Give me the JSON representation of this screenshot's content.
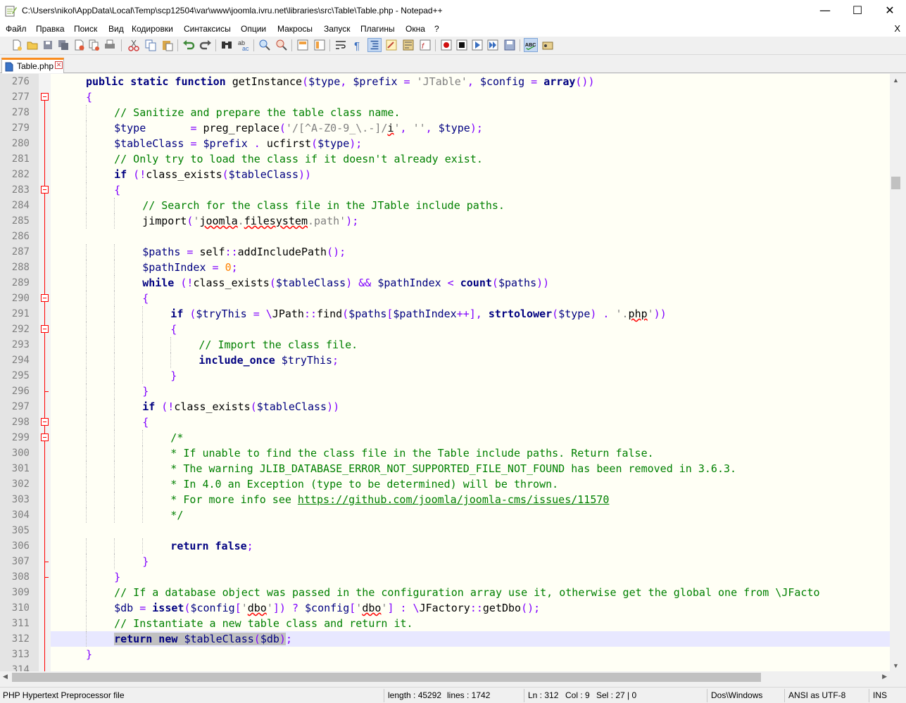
{
  "window": {
    "title": "C:\\Users\\nikol\\AppData\\Local\\Temp\\scp12504\\var\\www\\joomla.ivru.net\\libraries\\src\\Table\\Table.php - Notepad++",
    "minimize": "—",
    "maximize": "☐",
    "close": "✕"
  },
  "menu": {
    "items": [
      "Файл",
      "Правка",
      "Поиск",
      "Вид",
      "Кодировки",
      "Синтаксисы",
      "Опции",
      "Макросы",
      "Запуск",
      "Плагины",
      "Окна",
      "?"
    ],
    "close": "X"
  },
  "toolbar": {
    "icons": [
      "new-file-icon",
      "open-file-icon",
      "save-icon",
      "save-all-icon",
      "close-icon",
      "close-all-icon",
      "print-icon",
      "cut-icon",
      "copy-icon",
      "paste-icon",
      "undo-icon",
      "redo-icon",
      "find-icon",
      "replace-icon",
      "zoom-in-icon",
      "zoom-out-icon",
      "sync-v-icon",
      "sync-h-icon",
      "word-wrap-icon",
      "show-all-chars-icon",
      "indent-guide-icon",
      "udl-icon",
      "doc-map-icon",
      "function-list-icon",
      "record-macro-icon",
      "stop-macro-icon",
      "play-macro-icon",
      "run-macro-multiple-icon",
      "save-macro-icon",
      "spell-check-icon",
      "spell-options-icon"
    ]
  },
  "tab": {
    "label": "Table.php",
    "close": "✕"
  },
  "editor": {
    "lines": [
      {
        "n": "276"
      },
      {
        "n": "277"
      },
      {
        "n": "278"
      },
      {
        "n": "279"
      },
      {
        "n": "280"
      },
      {
        "n": "281"
      },
      {
        "n": "282"
      },
      {
        "n": "283"
      },
      {
        "n": "284"
      },
      {
        "n": "285"
      },
      {
        "n": "286"
      },
      {
        "n": "287"
      },
      {
        "n": "288"
      },
      {
        "n": "289"
      },
      {
        "n": "290"
      },
      {
        "n": "291"
      },
      {
        "n": "292"
      },
      {
        "n": "293"
      },
      {
        "n": "294"
      },
      {
        "n": "295"
      },
      {
        "n": "296"
      },
      {
        "n": "297"
      },
      {
        "n": "298"
      },
      {
        "n": "299"
      },
      {
        "n": "300"
      },
      {
        "n": "301"
      },
      {
        "n": "302"
      },
      {
        "n": "303"
      },
      {
        "n": "304"
      },
      {
        "n": "305"
      },
      {
        "n": "306"
      },
      {
        "n": "307"
      },
      {
        "n": "308"
      },
      {
        "n": "309"
      },
      {
        "n": "310"
      },
      {
        "n": "311"
      },
      {
        "n": "312"
      },
      {
        "n": "313"
      },
      {
        "n": "314"
      }
    ],
    "code": {
      "l276": [
        [
          "kw",
          "public static function "
        ],
        [
          "fn",
          "getInstance"
        ],
        [
          "op",
          "("
        ],
        [
          "var",
          "$type"
        ],
        [
          "op",
          ", "
        ],
        [
          "var",
          "$prefix"
        ],
        [
          "op",
          " = "
        ],
        [
          "st",
          "'JTable'"
        ],
        [
          "op",
          ", "
        ],
        [
          "var",
          "$config"
        ],
        [
          "op",
          " = "
        ],
        [
          "kw",
          "array"
        ],
        [
          "op",
          "())"
        ]
      ],
      "l277": [
        [
          "op",
          "{"
        ]
      ],
      "l278": [
        [
          "cm",
          "// Sanitize and prepare the table class name."
        ]
      ],
      "l279": [
        [
          "var",
          "$type"
        ],
        [
          "op",
          "       = "
        ],
        [
          "fn",
          "preg_replace"
        ],
        [
          "op",
          "("
        ],
        [
          "st",
          "'/[^A-Z0-9_\\.-]/"
        ],
        [
          "sp",
          "i"
        ],
        [
          "st",
          "'"
        ],
        [
          "op",
          ", "
        ],
        [
          "st",
          "''"
        ],
        [
          "op",
          ", "
        ],
        [
          "var",
          "$type"
        ],
        [
          "op",
          ");"
        ]
      ],
      "l280": [
        [
          "var",
          "$tableClass"
        ],
        [
          "op",
          " = "
        ],
        [
          "var",
          "$prefix"
        ],
        [
          "op",
          " . "
        ],
        [
          "fn",
          "ucfirst"
        ],
        [
          "op",
          "("
        ],
        [
          "var",
          "$type"
        ],
        [
          "op",
          ");"
        ]
      ],
      "l281": [
        [
          "cm",
          "// Only try to load the class if it doesn't already exist."
        ]
      ],
      "l282": [
        [
          "kw",
          "if"
        ],
        [
          "op",
          " (!"
        ],
        [
          "fn",
          "class_exists"
        ],
        [
          "op",
          "("
        ],
        [
          "var",
          "$tableClass"
        ],
        [
          "op",
          "))"
        ]
      ],
      "l283": [
        [
          "op",
          "{"
        ]
      ],
      "l284": [
        [
          "cm",
          "// Search for the class file in the JTable include paths."
        ]
      ],
      "l285": [
        [
          "fn",
          "jimport"
        ],
        [
          "op",
          "("
        ],
        [
          "st",
          "'"
        ],
        [
          "sp",
          "joomla"
        ],
        [
          "st",
          "."
        ],
        [
          "sp",
          "filesystem"
        ],
        [
          "st",
          ".path'"
        ],
        [
          "op",
          ");"
        ]
      ],
      "l286": [],
      "l287": [
        [
          "var",
          "$paths"
        ],
        [
          "op",
          " = "
        ],
        [
          "fn",
          "self"
        ],
        [
          "op",
          "::"
        ],
        [
          "fn",
          "addIncludePath"
        ],
        [
          "op",
          "();"
        ]
      ],
      "l288": [
        [
          "var",
          "$pathIndex"
        ],
        [
          "op",
          " = "
        ],
        [
          "num",
          "0"
        ],
        [
          "op",
          ";"
        ]
      ],
      "l289": [
        [
          "kw",
          "while"
        ],
        [
          "op",
          " (!"
        ],
        [
          "fn",
          "class_exists"
        ],
        [
          "op",
          "("
        ],
        [
          "var",
          "$tableClass"
        ],
        [
          "op",
          ") && "
        ],
        [
          "var",
          "$pathIndex"
        ],
        [
          "op",
          " < "
        ],
        [
          "kw",
          "count"
        ],
        [
          "op",
          "("
        ],
        [
          "var",
          "$paths"
        ],
        [
          "op",
          "))"
        ]
      ],
      "l290": [
        [
          "op",
          "{"
        ]
      ],
      "l291": [
        [
          "kw",
          "if"
        ],
        [
          "op",
          " ("
        ],
        [
          "var",
          "$tryThis"
        ],
        [
          "op",
          " = \\"
        ],
        [
          "fn",
          "JPath"
        ],
        [
          "op",
          "::"
        ],
        [
          "fn",
          "find"
        ],
        [
          "op",
          "("
        ],
        [
          "var",
          "$paths"
        ],
        [
          "op",
          "["
        ],
        [
          "var",
          "$pathIndex"
        ],
        [
          "op",
          "++], "
        ],
        [
          "kw",
          "strtolower"
        ],
        [
          "op",
          "("
        ],
        [
          "var",
          "$type"
        ],
        [
          "op",
          ") . "
        ],
        [
          "st",
          "'."
        ],
        [
          "sp",
          "php"
        ],
        [
          "st",
          "'"
        ],
        [
          "op",
          "))"
        ]
      ],
      "l292": [
        [
          "op",
          "{"
        ]
      ],
      "l293": [
        [
          "cm",
          "// Import the class file."
        ]
      ],
      "l294": [
        [
          "kw",
          "include_once"
        ],
        [
          "op",
          " "
        ],
        [
          "var",
          "$tryThis"
        ],
        [
          "op",
          ";"
        ]
      ],
      "l295": [
        [
          "op",
          "}"
        ]
      ],
      "l296": [
        [
          "op",
          "}"
        ]
      ],
      "l297": [
        [
          "kw",
          "if"
        ],
        [
          "op",
          " (!"
        ],
        [
          "fn",
          "class_exists"
        ],
        [
          "op",
          "("
        ],
        [
          "var",
          "$tableClass"
        ],
        [
          "op",
          "))"
        ]
      ],
      "l298": [
        [
          "op",
          "{"
        ]
      ],
      "l299": [
        [
          "cm",
          "/*"
        ]
      ],
      "l300": [
        [
          "cm",
          "* If unable to find the class file in the Table include paths. Return false."
        ]
      ],
      "l301": [
        [
          "cm",
          "* The warning JLIB_DATABASE_ERROR_NOT_SUPPORTED_FILE_NOT_FOUND has been removed in 3.6.3."
        ]
      ],
      "l302": [
        [
          "cm",
          "* In 4.0 an Exception (type to be determined) will be thrown."
        ]
      ],
      "l303": [
        [
          "cm",
          "* For more info see "
        ],
        [
          "lnk",
          "https://github.com/joomla/joomla-cms/issues/11570"
        ]
      ],
      "l304": [
        [
          "cm",
          "*/"
        ]
      ],
      "l305": [],
      "l306": [
        [
          "kw",
          "return false"
        ],
        [
          "op",
          ";"
        ]
      ],
      "l307": [
        [
          "op",
          "}"
        ]
      ],
      "l308": [
        [
          "op",
          "}"
        ]
      ],
      "l309": [
        [
          "cm",
          "// If a database object was passed in the configuration array use it, otherwise get the global one from \\JFacto"
        ]
      ],
      "l310": [
        [
          "var",
          "$db"
        ],
        [
          "op",
          " = "
        ],
        [
          "kw",
          "isset"
        ],
        [
          "op",
          "("
        ],
        [
          "var",
          "$config"
        ],
        [
          "op",
          "["
        ],
        [
          "st",
          "'"
        ],
        [
          "sp",
          "dbo"
        ],
        [
          "st",
          "'"
        ],
        [
          "op",
          "]) ? "
        ],
        [
          "var",
          "$config"
        ],
        [
          "op",
          "["
        ],
        [
          "st",
          "'"
        ],
        [
          "sp",
          "dbo"
        ],
        [
          "st",
          "'"
        ],
        [
          "op",
          "] : \\"
        ],
        [
          "fn",
          "JFactory"
        ],
        [
          "op",
          "::"
        ],
        [
          "fn",
          "getDbo"
        ],
        [
          "op",
          "();"
        ]
      ],
      "l311": [
        [
          "cm",
          "// Instantiate a new table class and return it."
        ]
      ],
      "l312": [
        [
          "sel-kw",
          "return new "
        ],
        [
          "sel-var",
          "$tableClass"
        ],
        [
          "sel-op",
          "("
        ],
        [
          "sel-var",
          "$db"
        ],
        [
          "sel-op",
          ")"
        ],
        [
          "op",
          ";"
        ]
      ],
      "l313": [
        [
          "op",
          "}"
        ]
      ],
      "l314": []
    }
  },
  "status": {
    "filetype": "PHP Hypertext Preprocessor file",
    "length": "length : 45292",
    "lines": "lines : 1742",
    "ln": "Ln : 312",
    "col": "Col : 9",
    "sel": "Sel : 27 | 0",
    "eol": "Dos\\Windows",
    "encoding": "ANSI as UTF-8",
    "mode": "INS"
  }
}
